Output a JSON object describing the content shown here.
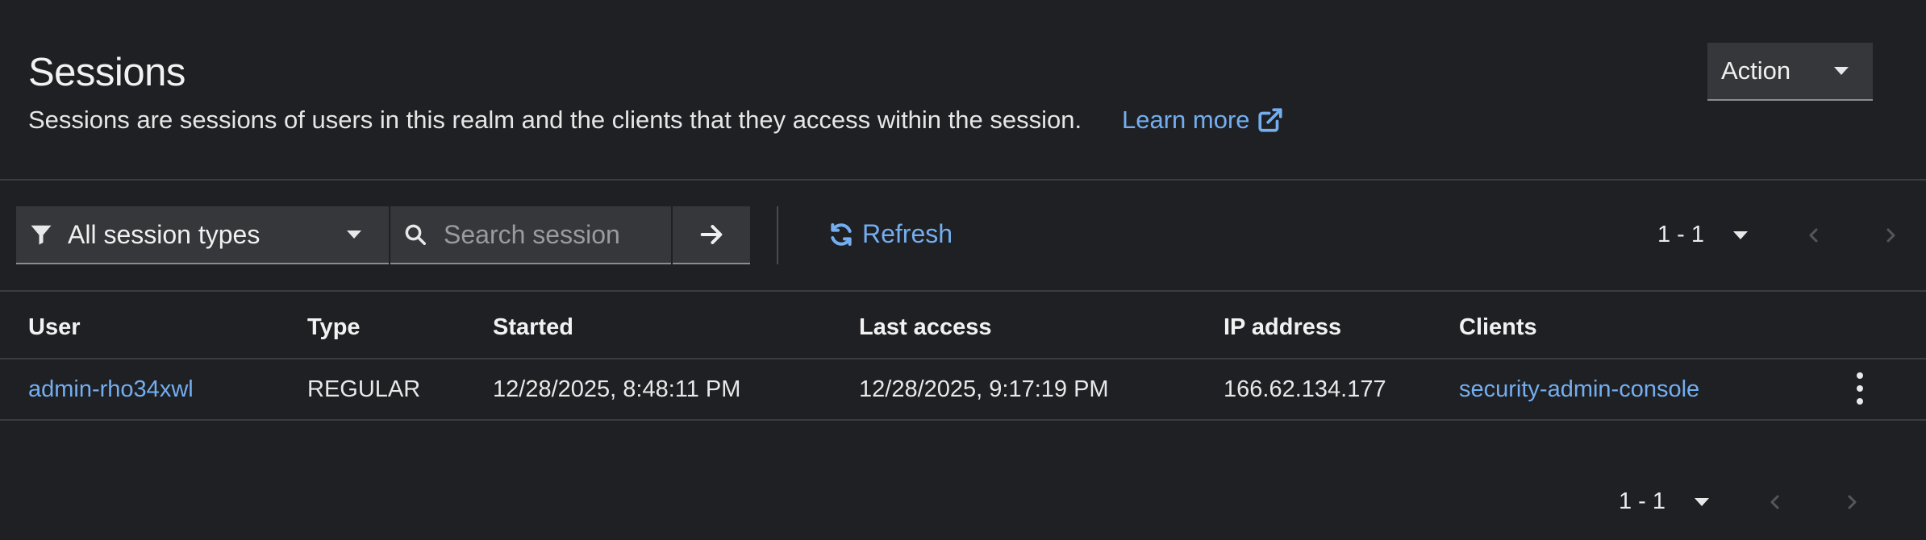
{
  "header": {
    "title": "Sessions",
    "description": "Sessions are sessions of users in this realm and the clients that they access within the session.",
    "learn_more": "Learn more",
    "action_label": "Action"
  },
  "toolbar": {
    "filter_label": "All session types",
    "search_placeholder": "Search session",
    "refresh_label": "Refresh",
    "pagination_range": "1 - 1"
  },
  "table": {
    "columns": [
      "User",
      "Type",
      "Started",
      "Last access",
      "IP address",
      "Clients"
    ],
    "rows": [
      {
        "user": "admin-rho34xwl",
        "type": "REGULAR",
        "started": "12/28/2025, 8:48:11 PM",
        "last_access": "12/28/2025, 9:17:19 PM",
        "ip": "166.62.134.177",
        "clients": "security-admin-console"
      }
    ]
  },
  "footer": {
    "pagination_range": "1 - 1"
  },
  "colors": {
    "background": "#1f2024",
    "link": "#73aef0",
    "control_bg": "#36373b"
  }
}
